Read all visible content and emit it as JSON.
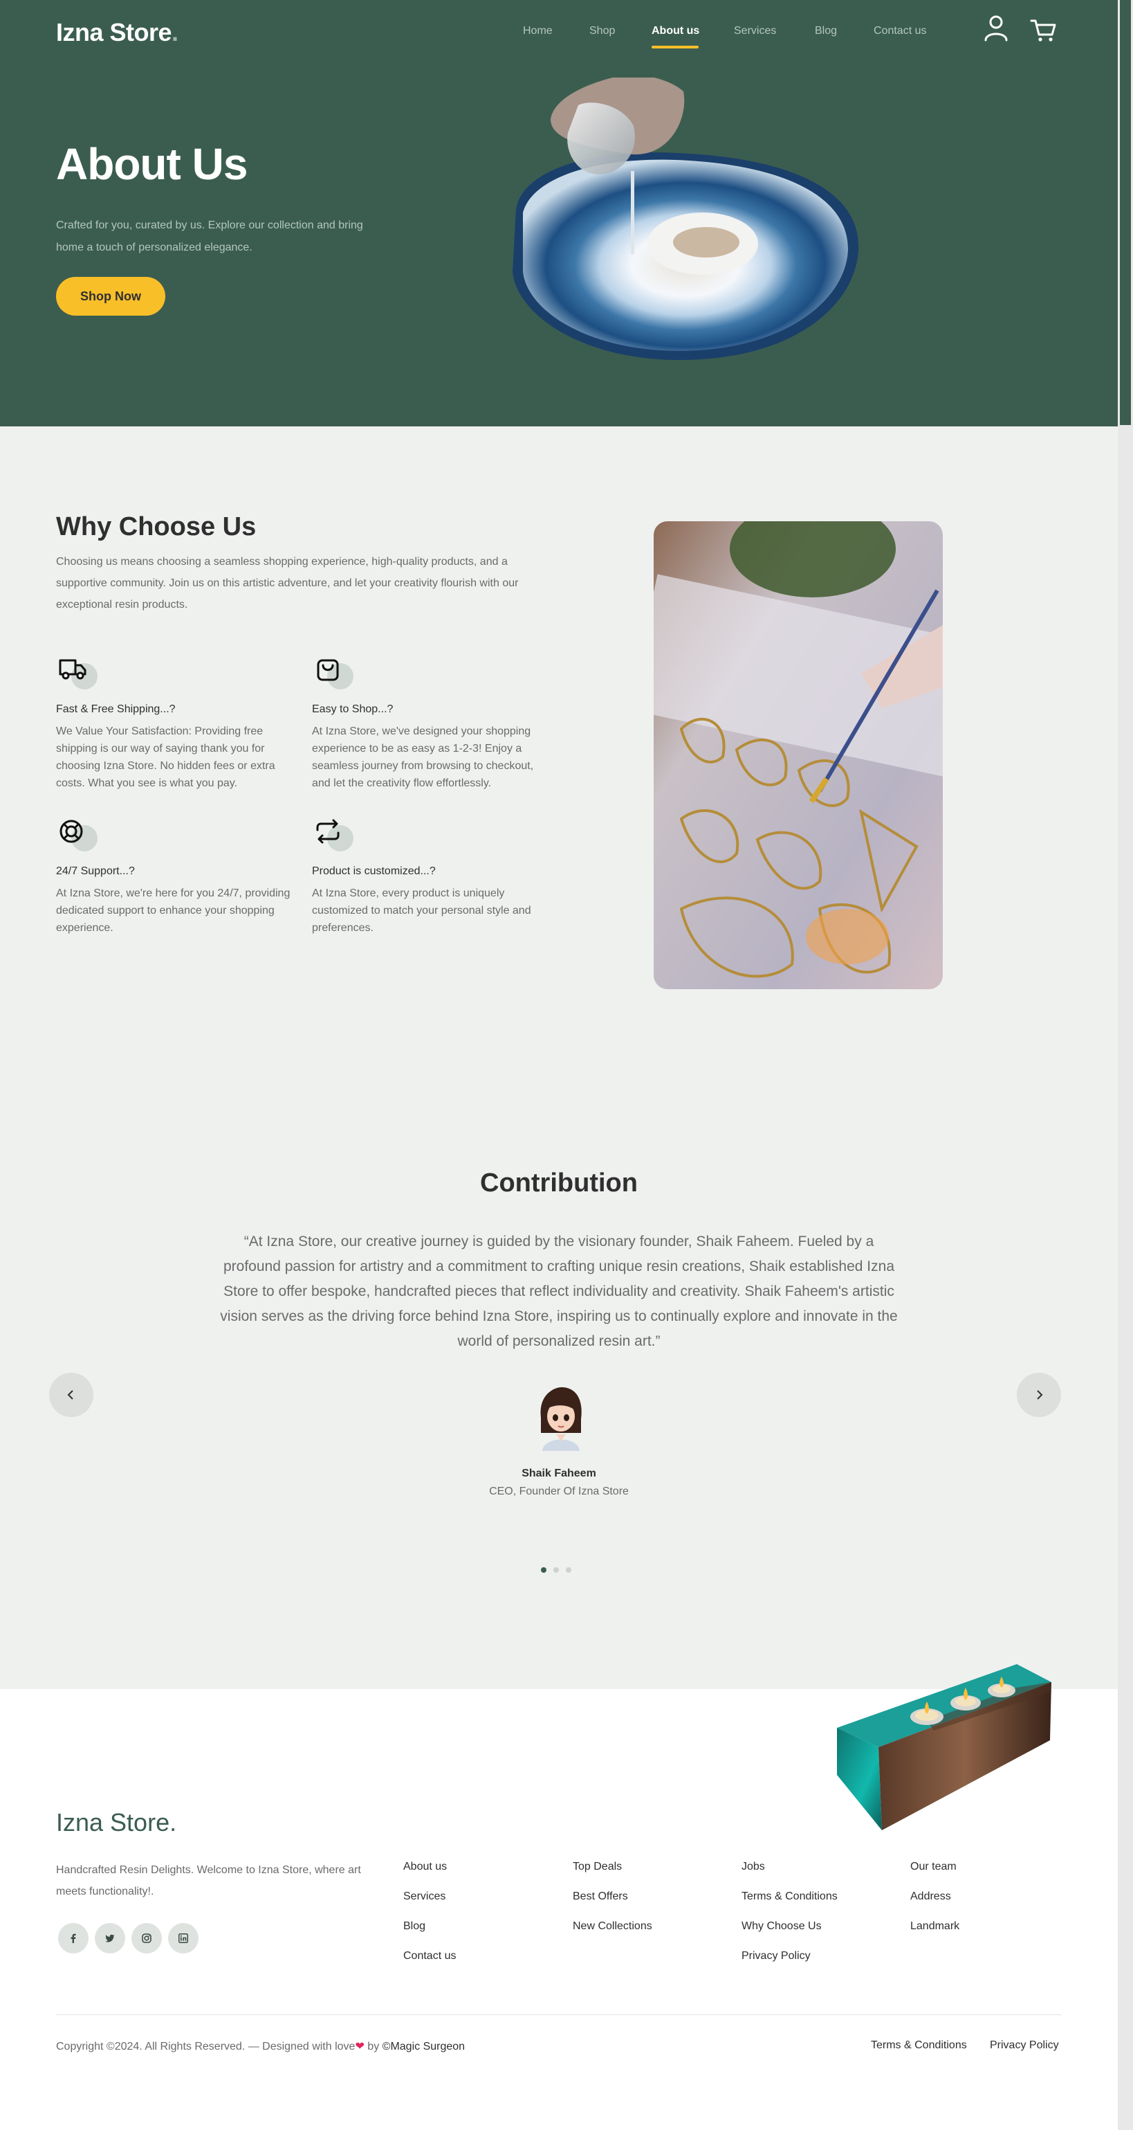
{
  "header": {
    "brand": "Izna Store",
    "brand_dot": ".",
    "nav": [
      "Home",
      "Shop",
      "About us",
      "Services",
      "Blog",
      "Contact us"
    ],
    "active_nav": "About us",
    "icons": [
      "user-icon",
      "cart-icon"
    ]
  },
  "hero": {
    "title": "About Us",
    "subtitle": "Crafted for you, curated by us. Explore our collection and bring home a touch of personalized elegance.",
    "cta": "Shop Now"
  },
  "why": {
    "title": "Why Choose Us",
    "description": "Choosing us means choosing a seamless shopping experience, high-quality products, and a supportive community. Join us on this artistic adventure, and let your creativity flourish with our exceptional resin products.",
    "features": [
      {
        "icon": "truck-icon",
        "title": "Fast & Free Shipping...?",
        "text": "We Value Your Satisfaction: Providing free shipping is our way of saying thank you for choosing Izna Store. No hidden fees or extra costs. What you see is what you pay."
      },
      {
        "icon": "bag-icon",
        "title": "Easy to Shop...?",
        "text": "At Izna Store, we've designed your shopping experience to be as easy as 1-2-3! Enjoy a seamless journey from browsing to checkout, and let the creativity flow effortlessly."
      },
      {
        "icon": "lifebuoy-icon",
        "title": "24/7 Support...?",
        "text": "At Izna Store, we're here for you 24/7, providing dedicated support to enhance your shopping experience."
      },
      {
        "icon": "repeat-icon",
        "title": "Product is customized...?",
        "text": "At Izna Store, every product is uniquely customized to match your personal style and preferences."
      }
    ]
  },
  "contribution": {
    "title": "Contribution",
    "quote": "“At Izna Store, our creative journey is guided by the visionary founder, Shaik Faheem. Fueled by a profound passion for artistry and a commitment to crafting unique resin creations, Shaik established Izna Store to offer bespoke, handcrafted pieces that reflect individuality and creativity. Shaik Faheem's artistic vision serves as the driving force behind Izna Store, inspiring us to continually explore and innovate in the world of personalized resin art.”",
    "author": "Shaik Faheem",
    "role": "CEO, Founder Of Izna Store",
    "slide_count": 3,
    "active_slide": 1
  },
  "footer": {
    "brand": "Izna Store.",
    "description": "Handcrafted Resin Delights. Welcome to Izna Store, where art meets functionality!.",
    "socials": [
      "facebook-icon",
      "twitter-icon",
      "instagram-icon",
      "linkedin-icon"
    ],
    "columns": [
      [
        "About us",
        "Services",
        "Blog",
        "Contact us"
      ],
      [
        "Top Deals",
        "Best Offers",
        "New Collections"
      ],
      [
        "Jobs",
        "Terms & Conditions",
        "Why Choose Us",
        "Privacy Policy"
      ],
      [
        "Our team",
        "Address",
        "Landmark"
      ]
    ],
    "copyright": "Copyright ©2024. All Rights Reserved. — Designed with love",
    "heart": "❤",
    "by": " by ",
    "credit": "©Magic Surgeon",
    "legal": [
      "Terms & Conditions",
      "Privacy Policy"
    ]
  },
  "colors": {
    "primary": "#3b5d50",
    "accent": "#f9bf29",
    "background": "#eff1ef"
  }
}
